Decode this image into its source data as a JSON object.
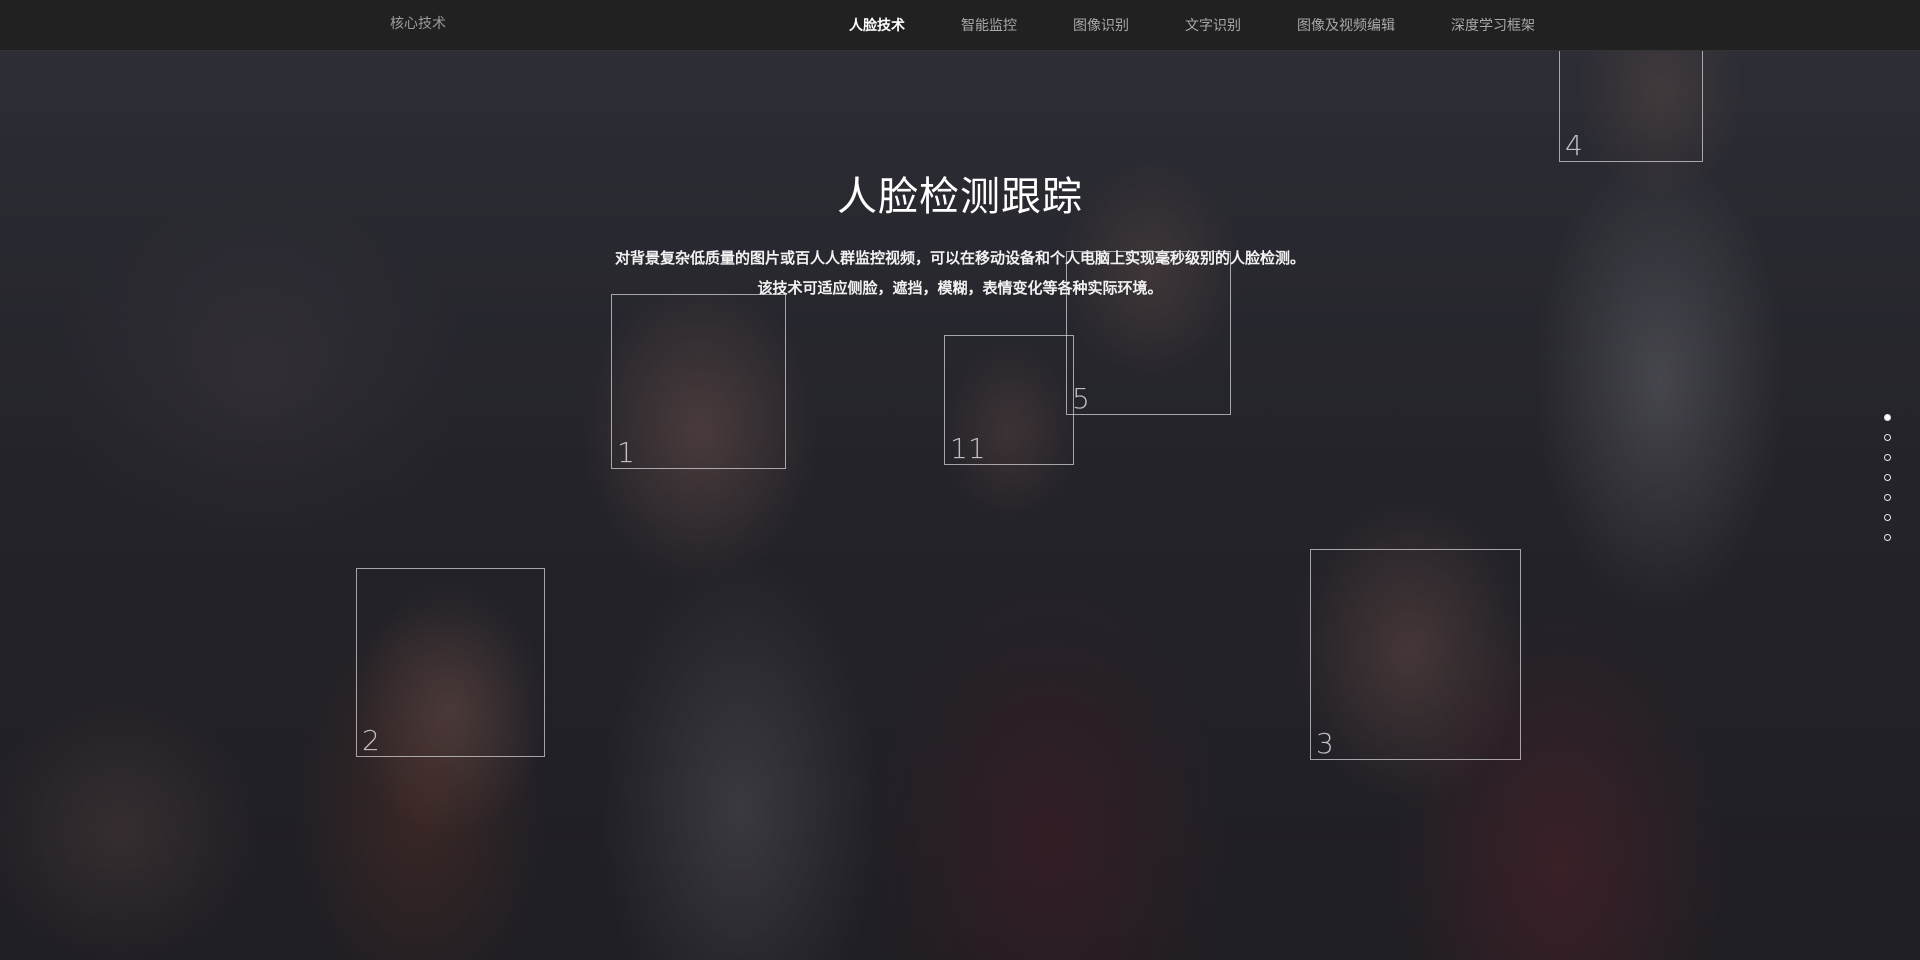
{
  "nav": {
    "brand": "核心技术",
    "items": [
      {
        "label": "人脸技术",
        "active": true
      },
      {
        "label": "智能监控",
        "active": false
      },
      {
        "label": "图像识别",
        "active": false
      },
      {
        "label": "文字识别",
        "active": false
      },
      {
        "label": "图像及视频编辑",
        "active": false
      },
      {
        "label": "深度学习框架",
        "active": false
      }
    ]
  },
  "hero": {
    "title": "人脸检测跟踪",
    "description_line1": "对背景复杂低质量的图片或百人人群监控视频，可以在移动设备和个人电脑上实现毫秒级别的人脸检测。",
    "description_line2": "该技术可适应侧脸，遮挡，模糊，表情变化等各种实际环境。"
  },
  "faces": [
    {
      "id": "1"
    },
    {
      "id": "2"
    },
    {
      "id": "3"
    },
    {
      "id": "4"
    },
    {
      "id": "5"
    },
    {
      "id": "11"
    }
  ],
  "slide_dots": {
    "count": 7,
    "active_index": 0
  },
  "colors": {
    "navbar_bg": "#212121",
    "nav_active": "#ffffff",
    "nav_inactive": "#a8a8a8"
  }
}
